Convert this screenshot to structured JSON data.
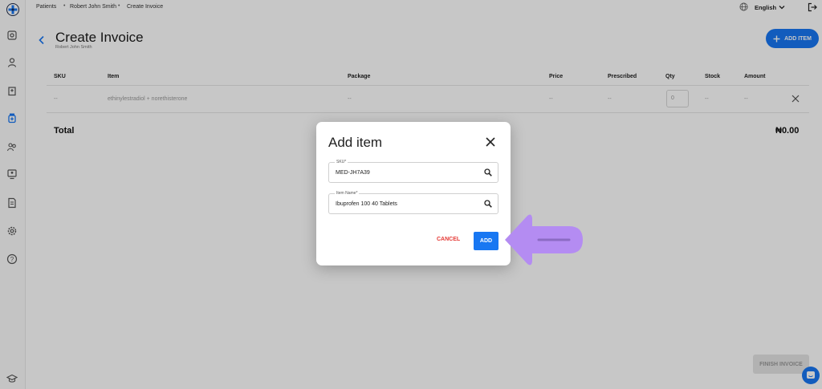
{
  "colors": {
    "accent": "#1877f2",
    "danger": "#e53935",
    "annotation": "#b48cf2"
  },
  "sidebar": {
    "logo": "plus-medical-logo",
    "items": [
      "dashboard-icon",
      "user-icon",
      "hospital-icon",
      "medicine-bottle-icon",
      "users-icon",
      "monitor-user-icon",
      "document-icon",
      "settings-icon",
      "help-icon"
    ],
    "bottom": "graduation-cap-icon"
  },
  "breadcrumb": {
    "items": [
      "Patients",
      "Robert John Smith",
      "Create Invoice"
    ],
    "separator": "•"
  },
  "header": {
    "language": "English"
  },
  "page": {
    "title": "Create Invoice",
    "subtitle": "Robert John Smith",
    "add_item_label": "ADD ITEM"
  },
  "table": {
    "columns": [
      "SKU",
      "Item",
      "Package",
      "Price",
      "Prescribed",
      "Qty",
      "Stock",
      "Amount"
    ],
    "row": {
      "sku": "--",
      "item": "ethinylestradiol + norethisterone",
      "package": "--",
      "price": "--",
      "prescribed": "--",
      "qty": "0",
      "stock": "--",
      "amount": "--"
    },
    "total_label": "Total",
    "total_value": "₦0.00"
  },
  "finish_label": "FINISH INVOICE",
  "modal": {
    "title": "Add item",
    "sku_label": "SKU*",
    "sku_value": "MED-JH7A39",
    "name_label": "Item Name*",
    "name_value": "Ibuprofen 100 40 Tablets",
    "cancel_label": "CANCEL",
    "add_label": "ADD"
  }
}
